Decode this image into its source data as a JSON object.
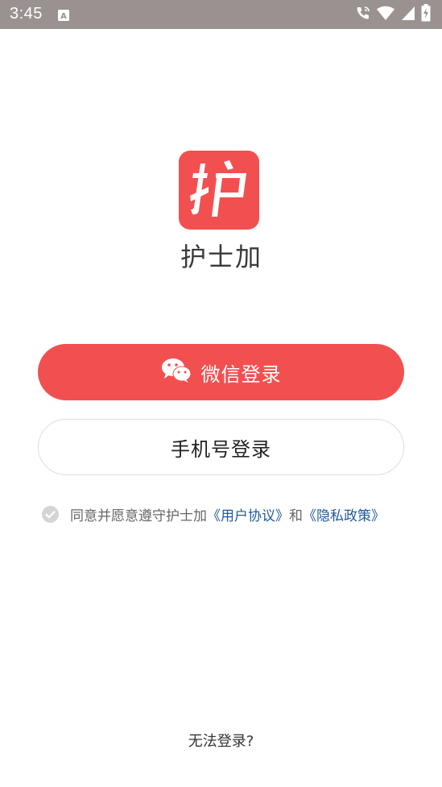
{
  "status_bar": {
    "time": "3:45",
    "icons": [
      "text-a-icon",
      "phone-call-icon",
      "wifi-icon",
      "signal-icon",
      "battery-charging-icon"
    ]
  },
  "app": {
    "logo_char": "护",
    "name": "护士加",
    "brand_color": "#f25050"
  },
  "login": {
    "wechat_label": "微信登录",
    "wechat_icon": "wechat-icon",
    "phone_label": "手机号登录"
  },
  "agreement": {
    "prefix": "同意并愿意遵守护士加",
    "user_agreement": "《用户协议》",
    "conjunction": "和",
    "privacy_policy": "《隐私政策》",
    "checked": false
  },
  "footer": {
    "cannot_login": "无法登录?"
  }
}
